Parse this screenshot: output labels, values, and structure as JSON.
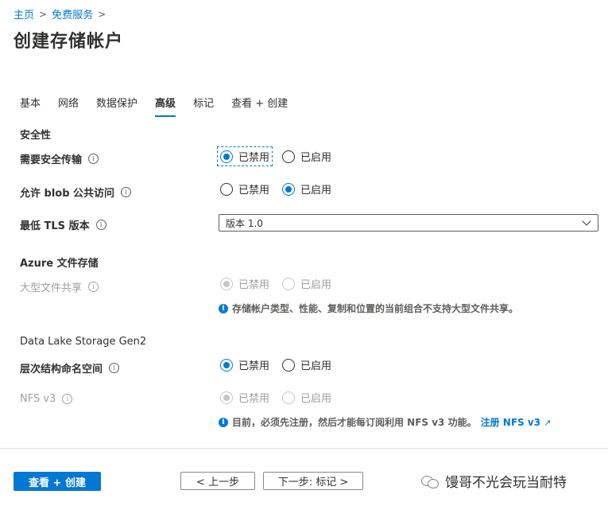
{
  "breadcrumb": [
    "主页",
    "免费服务"
  ],
  "page_title": "创建存储帐户",
  "tabs": [
    "基本",
    "网络",
    "数据保护",
    "高级",
    "标记",
    "查看 + 创建"
  ],
  "active_tab": "高级",
  "sections": {
    "security": {
      "title": "安全性",
      "secure_transfer": {
        "label": "需要安全传输",
        "options": [
          "已禁用",
          "已启用"
        ],
        "selected": "已禁用"
      },
      "blob_public": {
        "label": "允许 blob 公共访问",
        "options": [
          "已禁用",
          "已启用"
        ],
        "selected": "已启用"
      },
      "tls": {
        "label": "最低 TLS 版本",
        "value": "版本 1.0"
      }
    },
    "azure_files": {
      "title": "Azure 文件存储",
      "large_share": {
        "label": "大型文件共享",
        "options": [
          "已禁用",
          "已启用"
        ],
        "selected": "已禁用",
        "disabled": true
      },
      "note": "存储帐户类型、性能、复制和位置的当前组合不支持大型文件共享。"
    },
    "data_lake": {
      "title": "Data Lake Storage Gen2",
      "hns": {
        "label": "层次结构命名空间",
        "options": [
          "已禁用",
          "已启用"
        ],
        "selected": "已禁用"
      },
      "nfs": {
        "label": "NFS v3",
        "options": [
          "已禁用",
          "已启用"
        ],
        "selected": "已禁用",
        "disabled": true
      },
      "note": "目前，必须先注册，然后才能每订阅利用 NFS v3 功能。",
      "link": "注册 NFS v3"
    }
  },
  "footer": {
    "review_create": "查看 + 创建",
    "prev": "< 上一步",
    "next": "下一步: 标记 >"
  },
  "watermark": "馒哥不光会玩当耐特",
  "colors": {
    "accent": "#0078d4",
    "text": "#323130",
    "disabled": "#a19f9d"
  },
  "icons": [
    "chevron-right-icon",
    "info-icon",
    "chevron-down-icon",
    "info-filled-icon",
    "external-link-icon",
    "wechat-icon"
  ]
}
